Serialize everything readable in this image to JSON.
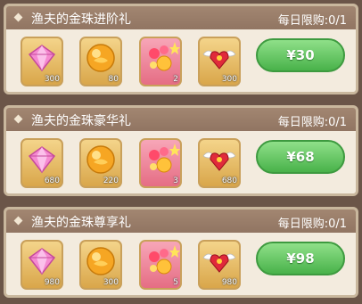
{
  "colors": {
    "header": "#9a7e6a",
    "body": "#f3ebde",
    "price_button": "#49b24a"
  },
  "packs": [
    {
      "title": "渔夫的金珠进阶礼",
      "limit": "每日限购:0/1",
      "price": "¥30",
      "items": [
        {
          "icon": "gem-icon",
          "count": "300"
        },
        {
          "icon": "gold-pearl-icon",
          "count": "80"
        },
        {
          "icon": "lucky-bag-icon",
          "count": "2"
        },
        {
          "icon": "winged-heart-icon",
          "count": "300"
        }
      ]
    },
    {
      "title": "渔夫的金珠豪华礼",
      "limit": "每日限购:0/1",
      "price": "¥68",
      "items": [
        {
          "icon": "gem-icon",
          "count": "680"
        },
        {
          "icon": "gold-pearl-icon",
          "count": "220"
        },
        {
          "icon": "lucky-bag-icon",
          "count": "3"
        },
        {
          "icon": "winged-heart-icon",
          "count": "680"
        }
      ]
    },
    {
      "title": "渔夫的金珠尊享礼",
      "limit": "每日限购:0/1",
      "price": "¥98",
      "items": [
        {
          "icon": "gem-icon",
          "count": "980"
        },
        {
          "icon": "gold-pearl-icon",
          "count": "300"
        },
        {
          "icon": "lucky-bag-icon",
          "count": "5"
        },
        {
          "icon": "winged-heart-icon",
          "count": "980"
        }
      ]
    }
  ]
}
